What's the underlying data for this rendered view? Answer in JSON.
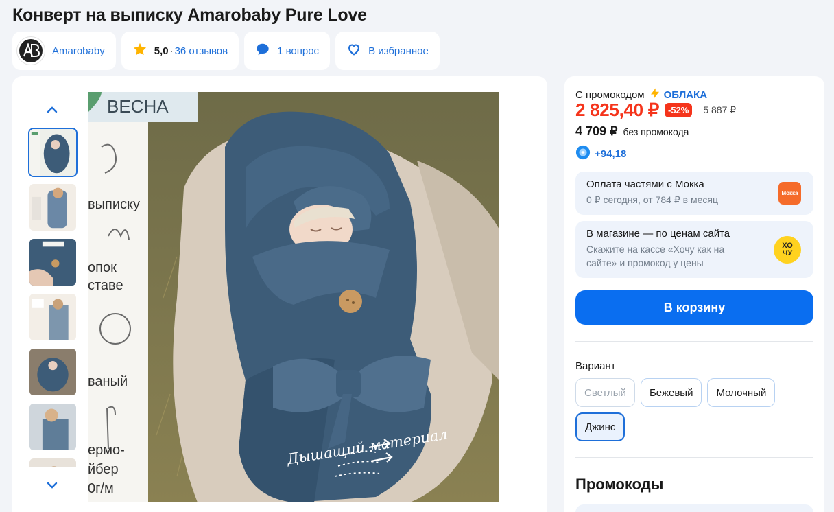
{
  "product": {
    "title": "Конверт на выписку Amarobaby Pure Love"
  },
  "chips": {
    "brand": "Amarobaby",
    "rating_value": "5,0",
    "rating_sep": "·",
    "reviews": "36 отзывов",
    "questions": "1 вопрос",
    "favorites": "В избранное"
  },
  "image": {
    "banner_top": "ВЕСНА",
    "side_texts": [
      "выписку",
      "опок",
      "ставе",
      "ваный",
      "ермо-",
      "йбер",
      "0г/м"
    ],
    "caption": "Дышащий материал"
  },
  "price": {
    "promo_label": "С промокодом",
    "promo_code": "ОБЛАКА",
    "current": "2 825,40 ₽",
    "discount": "-52%",
    "old": "5 887 ₽",
    "no_promo_price": "4 709 ₽",
    "no_promo_label": "без промокода",
    "bonus": "+94,18"
  },
  "mokka": {
    "title": "Оплата частями с Мокка",
    "subtitle": "0 ₽ сегодня, от 784 ₽ в месяц",
    "logo": "Мокка"
  },
  "store": {
    "title": "В магазине — по ценам сайта",
    "subtitle": "Скажите на кассе «Хочу как на сайте» и промокод у цены",
    "logo_top": "ХО",
    "logo_bottom": "ЧУ"
  },
  "cart": {
    "label": "В корзину"
  },
  "variants": {
    "label": "Вариант",
    "items": [
      "Светлый",
      "Бежевый",
      "Молочный",
      "Джинс"
    ]
  },
  "promocodes": {
    "title": "Промокоды"
  },
  "colors": {
    "accent": "#0a6ef0",
    "price_red": "#f5341b",
    "product_blue": "#3d5c78"
  }
}
